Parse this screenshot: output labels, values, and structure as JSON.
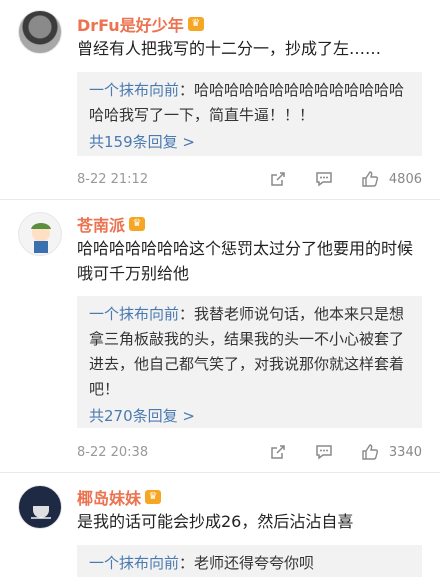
{
  "comments": [
    {
      "username": "DrFu是好少年",
      "text": "曾经有人把我写的十二分一，抄成了左……",
      "reply": {
        "name": "一个抹布向前",
        "content": "：哈哈哈哈哈哈哈哈哈哈哈哈哈哈哈哈我写了一下，简直牛逼！！！",
        "count_label": "共159条回复 >"
      },
      "time": "8-22 21:12",
      "likes": "4806"
    },
    {
      "username": "苍南派",
      "text": "哈哈哈哈哈哈哈这个惩罚太过分了他要用的时候 哦可千万别给他",
      "reply": {
        "name": "一个抹布向前",
        "content": "：我替老师说句话，他本来只是想拿三角板敲我的头，结果我的头一不小心被套了进去，他自己都气笑了，对我说那你就这样套着吧！",
        "count_label": "共270条回复 >"
      },
      "time": "8-22 20:38",
      "likes": "3340"
    },
    {
      "username": "椰岛妹妹",
      "text": "是我的话可能会抄成26，然后沾沾自喜",
      "reply": {
        "name": "一个抹布向前",
        "content": "：老师还得夸夸你呗"
      }
    }
  ],
  "icons": {
    "crown": "crown-icon",
    "share": "share-icon",
    "comment": "comment-icon",
    "like": "thumbs-up-icon"
  }
}
